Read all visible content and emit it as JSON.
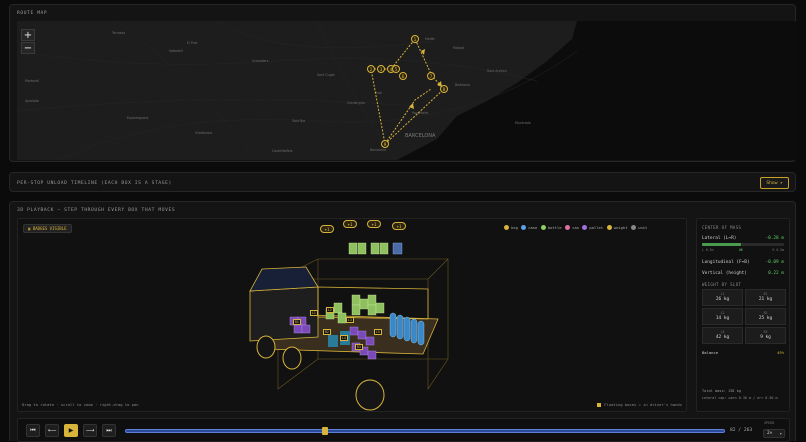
{
  "route_map": {
    "title": "ROUTE MAP",
    "zoom_in": "+",
    "zoom_out": "−",
    "place_labels": [
      "Terrassa",
      "Sabadell",
      "Granollers",
      "Mataró",
      "Sant Cugat",
      "Badalona",
      "Barcelona",
      "Hospitalet",
      "Castelldefels",
      "Martorell",
      "Igualada",
      "Rubí",
      "Mollet",
      "Cerdanyola",
      "Sant Boi",
      "Viladecans",
      "Montcada",
      "Esparreguera",
      "Sant Andreu",
      "El Prat"
    ],
    "city_label": "BARCELONA",
    "stops": [
      "1",
      "2",
      "3",
      "4",
      "5",
      "6",
      "7",
      "8",
      "9"
    ],
    "route_color": "#d9b43a"
  },
  "timeline": {
    "title": "PER-STOP UNLOAD TIMELINE (EACH BOX IS A STAGE)",
    "show_label": "Show ▸"
  },
  "playback": {
    "title": "3D PLAYBACK — STEP THROUGH EVERY BOX THAT MOVES",
    "badges_button": "▣ BADGES VISIBLE",
    "legend": [
      {
        "label": "keg",
        "color": "#d9b43a"
      },
      {
        "label": "case",
        "color": "#5aa0e8"
      },
      {
        "label": "bottle",
        "color": "#8ed060"
      },
      {
        "label": "can",
        "color": "#e070a0"
      },
      {
        "label": "pallet",
        "color": "#a070e0"
      },
      {
        "label": "weight",
        "color": "#d9b43a"
      },
      {
        "label": "unit",
        "color": "#888888"
      }
    ],
    "floating_badges": [
      "+1",
      "+1",
      "+1",
      "+1"
    ],
    "box_labels": [
      "L1",
      "L2",
      "L3",
      "L4",
      "R1",
      "R2",
      "R3",
      "L5"
    ],
    "hint_left": "Drag to rotate · scroll to zoom · right-drag to pan",
    "hint_right": "Floating boxes = in driver's hands"
  },
  "center_of_mass": {
    "title": "CENTER OF MASS",
    "lateral_label": "Lateral (L↔R)",
    "lateral_value": "-0.28 m",
    "lateral_fraction": 0.48,
    "lateral_min": "L 0.5m",
    "lateral_mid": "OK",
    "lateral_max": "R 0.5m",
    "longitudinal_label": "Longitudinal (F↔B)",
    "longitudinal_value": "-0.09 m",
    "vertical_label": "Vertical (height)",
    "vertical_value": "0.22 m",
    "weight_title": "WEIGHT BY SLOT",
    "slots": [
      {
        "label": "L1",
        "weight": "26 kg"
      },
      {
        "label": "R1",
        "weight": "21 kg"
      },
      {
        "label": "L2",
        "weight": "14 kg"
      },
      {
        "label": "R2",
        "weight": "25 kg"
      },
      {
        "label": "L3",
        "weight": "42 kg"
      },
      {
        "label": "R3",
        "weight": "9 kg"
      }
    ],
    "balance_label": "Balance",
    "balance_value": "49%",
    "total_mass": "Total mass: 138 kg",
    "lateral_cap": "Lateral cap: warn 0.30 m / err 0.50 m"
  },
  "controls": {
    "first": "⏮",
    "prev": "⟵",
    "play": "▶",
    "next": "⟶",
    "last": "⏭",
    "progress_fraction": 0.33,
    "counter": "82 / 263",
    "speed_label": "SPEED",
    "speed_value": "2×"
  }
}
